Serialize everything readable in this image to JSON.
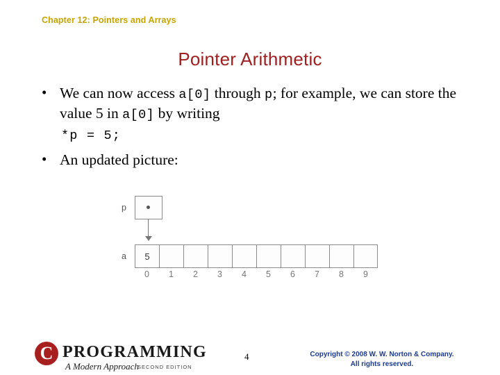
{
  "header": {
    "chapter": "Chapter 12: Pointers and Arrays"
  },
  "title": "Pointer Arithmetic",
  "bullets": [
    {
      "marker": "•",
      "segments": [
        {
          "text": "We can now access ",
          "style": "normal"
        },
        {
          "text": "a[0]",
          "style": "mono"
        },
        {
          "text": " through ",
          "style": "normal"
        },
        {
          "text": "p",
          "style": "mono"
        },
        {
          "text": "; for example, we can store the value 5 in ",
          "style": "normal"
        },
        {
          "text": "a[0]",
          "style": "mono"
        },
        {
          "text": " by writing",
          "style": "normal"
        }
      ]
    },
    {
      "marker": "•",
      "segments": [
        {
          "text": "An updated picture:",
          "style": "normal"
        }
      ]
    }
  ],
  "code_line": "*p = 5;",
  "diagram": {
    "pointer_label": "p",
    "array_label": "a",
    "pointer_value_icon": "dot-icon",
    "arrow_icon": "down-arrow-icon",
    "cells": [
      "5",
      "",
      "",
      "",
      "",
      "",
      "",
      "",
      "",
      ""
    ],
    "indices": [
      "0",
      "1",
      "2",
      "3",
      "4",
      "5",
      "6",
      "7",
      "8",
      "9"
    ]
  },
  "footer": {
    "logo_letter": "C",
    "logo_word": "PROGRAMMING",
    "logo_subtitle": "A Modern Approach",
    "logo_edition": "SECOND EDITION",
    "page_number": "4",
    "copyright_line1": "Copyright © 2008 W. W. Norton & Company.",
    "copyright_line2": "All rights reserved."
  }
}
